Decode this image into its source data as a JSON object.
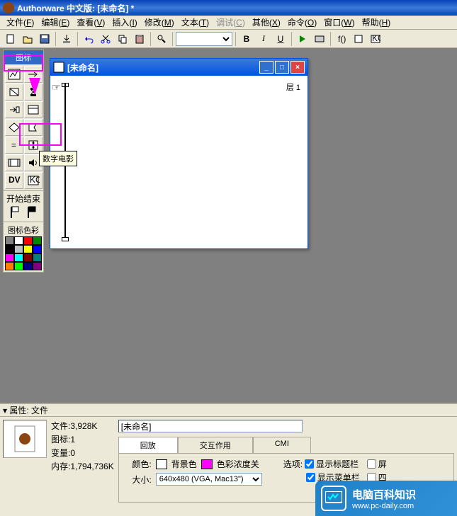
{
  "title_bar": {
    "text": "Authorware 中文版: [未命名] *"
  },
  "menu": {
    "items": [
      {
        "label": "文件",
        "key": "F"
      },
      {
        "label": "编辑",
        "key": "E"
      },
      {
        "label": "查看",
        "key": "V"
      },
      {
        "label": "插入",
        "key": "I"
      },
      {
        "label": "修改",
        "key": "M"
      },
      {
        "label": "文本",
        "key": "T"
      },
      {
        "label": "调试",
        "key": "C",
        "disabled": true
      },
      {
        "label": "其他",
        "key": "X"
      },
      {
        "label": "命令",
        "key": "O"
      },
      {
        "label": "窗口",
        "key": "W"
      },
      {
        "label": "帮助",
        "key": "H"
      }
    ]
  },
  "toolbar": {
    "bold": "B",
    "italic": "I",
    "underline": "U"
  },
  "palette": {
    "title": "图标",
    "start_end": {
      "start": "开始",
      "end": "结束"
    },
    "color_title": "图标色彩",
    "colors": [
      "#808080",
      "#ffffff",
      "#ff0000",
      "#008000",
      "#000000",
      "#c0c0c0",
      "#ffff00",
      "#0000ff",
      "#ff00ff",
      "#00ffff",
      "#800000",
      "#008080",
      "#ff8000",
      "#00ff00",
      "#000080",
      "#800080"
    ]
  },
  "tooltip": {
    "text": "数字电影"
  },
  "design_window": {
    "title": "[未命名]",
    "layer_label": "层 1"
  },
  "properties": {
    "header": "属性: 文件",
    "info": {
      "file": "文件:3,928K",
      "icons": "图标:1",
      "vars": "变量:0",
      "mem": "内存:1,794,736K"
    },
    "name": "[未命名]",
    "tabs": {
      "playback": "回放",
      "interaction": "交互作用",
      "cmi": "CMI"
    },
    "row1": {
      "color_label": "颜色:",
      "bg_label": "背景色",
      "depth_label": "色彩浓度关"
    },
    "row2": {
      "size_label": "大小:",
      "size_value": "640x480 (VGA, Mac13\")"
    },
    "options": {
      "label": "选项:",
      "show_title": "显示标题栏",
      "show_menu": "显示菜单栏",
      "cut1": "屏",
      "cut2": "四"
    }
  },
  "watermark": {
    "cn": "电脑百科知识",
    "url": "www.pc-daily.com"
  }
}
